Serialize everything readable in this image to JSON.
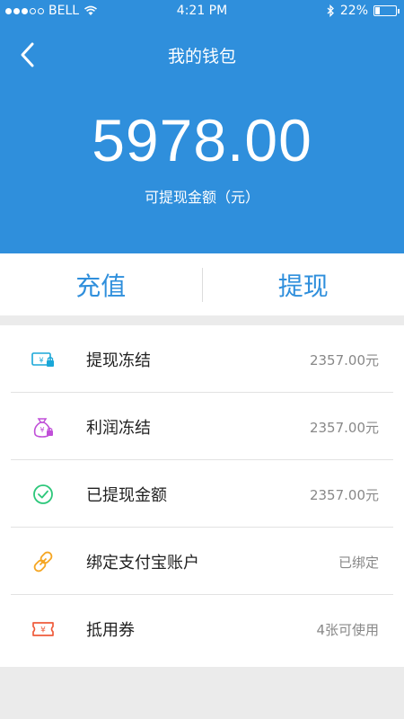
{
  "status_bar": {
    "carrier": "BELL",
    "time": "4:21 PM",
    "battery": "22%",
    "battery_level": 0.22
  },
  "nav": {
    "title": "我的钱包",
    "back_icon": "chevron-left-icon"
  },
  "balance": {
    "amount": "5978.00",
    "label": "可提现金额（元）"
  },
  "actions": {
    "recharge_label": "充值",
    "withdraw_label": "提现"
  },
  "list": {
    "items": [
      {
        "label": "提现冻结",
        "value": "2357.00元",
        "icon": "cash-lock-icon",
        "color": "#1aa7d8"
      },
      {
        "label": "利润冻结",
        "value": "2357.00元",
        "icon": "money-bag-lock-icon",
        "color": "#c04fd8"
      },
      {
        "label": "已提现金额",
        "value": "2357.00元",
        "icon": "check-circle-icon",
        "color": "#2cc77a"
      },
      {
        "label": "绑定支付宝账户",
        "value": "已绑定",
        "icon": "link-icon",
        "color": "#f5a623"
      },
      {
        "label": "抵用券",
        "value": "4张可使用",
        "icon": "coupon-icon",
        "color": "#ef5b3b"
      }
    ]
  },
  "colors": {
    "header_bg": "#2f8fdc",
    "accent": "#2f8fdc",
    "page_bg": "#ebebeb"
  }
}
